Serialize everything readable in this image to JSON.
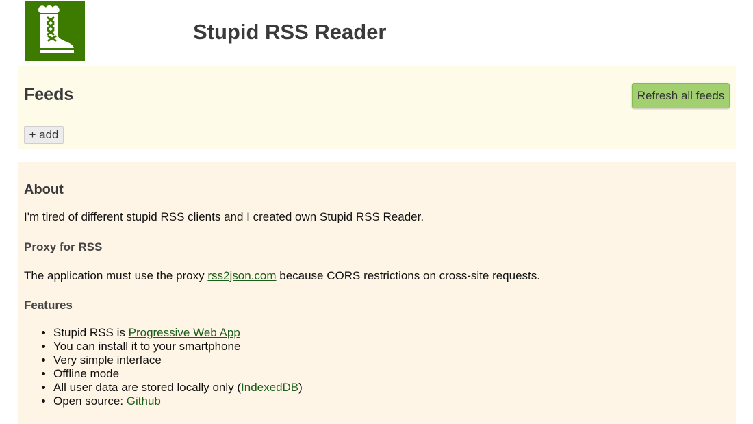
{
  "header": {
    "logo_icon": "boot-icon",
    "title": "Stupid RSS Reader"
  },
  "feeds": {
    "title": "Feeds",
    "refresh_label": "Refresh all feeds",
    "add_label": "+ add"
  },
  "about": {
    "title": "About",
    "intro": "I'm tired of different stupid RSS clients and I created own Stupid RSS Reader.",
    "proxy_heading": "Proxy for RSS",
    "proxy_text_before": "The application must use the proxy ",
    "proxy_link": "rss2json.com",
    "proxy_text_after": " because CORS restrictions on cross-site requests.",
    "features_heading": "Features",
    "features": {
      "pwa_prefix": "Stupid RSS is ",
      "pwa_link": "Progressive Web App",
      "install": "You can install it to your smartphone",
      "simple": "Very simple interface",
      "offline": "Offline mode",
      "storage_prefix": "All user data are stored locally only (",
      "storage_link": "IndexedDB",
      "storage_suffix": ")",
      "source_prefix": "Open source: ",
      "source_link": "Github"
    }
  },
  "colors": {
    "logo_bg": "#3d7a00",
    "feeds_panel_bg": "#fefbe9",
    "about_panel_bg": "#fef5e6",
    "refresh_button_bg": "#a2d071",
    "link": "#1a5e1a"
  }
}
